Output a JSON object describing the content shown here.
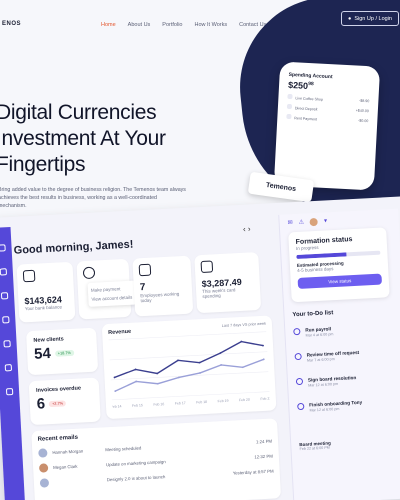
{
  "brand": "ENOS",
  "nav": {
    "items": [
      "Home",
      "About Us",
      "Portfolio",
      "How It Works",
      "Contact Us"
    ],
    "signup": "Sign Up / Login"
  },
  "hero": {
    "line1": "Digital Currencies",
    "line2": "Investment At Your",
    "line3": "Fingertips",
    "subtitle": "Bring added value to the degree of business religion. The Temenos team always achieves the best results in business, working as a well-coordinated mechanism."
  },
  "phone": {
    "title": "Spending Account",
    "amount": "$250",
    "amount_cents": "98",
    "rows": [
      {
        "label": "Live Coffee Shop",
        "value": "-$8.90"
      },
      {
        "label": "Direct Deposit",
        "value": "+$40.00"
      },
      {
        "label": "Rent Payment",
        "value": "-$0.00"
      }
    ]
  },
  "temenos_tag": "Temenos",
  "dashboard": {
    "greeting": "Good morning, James!",
    "balance": {
      "value": "$143,624",
      "label": "Your bank balance"
    },
    "dropdown": [
      "Make payment",
      "View account details"
    ],
    "employees": {
      "value": "7",
      "label": "Employees working today"
    },
    "spending": {
      "value": "$3,287.49",
      "label": "This week's card spending"
    },
    "new_clients": {
      "label": "New clients",
      "value": "54",
      "badge": "+18.7%"
    },
    "invoices": {
      "label": "Invoices overdue",
      "value": "6",
      "badge": "+2.7%"
    },
    "revenue": {
      "label": "Revenue",
      "legend": "Last 7 days VS prior week"
    },
    "recent_emails": "Recent emails",
    "emails": [
      {
        "name": "Hannah Morgan",
        "subject": "Meeting scheduled",
        "time": "1:24 PM"
      },
      {
        "name": "Megan Clark",
        "subject": "Update on marketing campaign",
        "time": "12:32 PM"
      },
      {
        "name": "",
        "subject": "Designly 2.0 is about to launch",
        "time": "Yesterday at 8:57 PM"
      }
    ]
  },
  "formation": {
    "title": "Formation status",
    "status": "In progress",
    "estimate_label": "Estimated processing",
    "estimate_value": "4-5 business days",
    "button": "View status"
  },
  "todo": {
    "title": "Your to-Do list",
    "items": [
      {
        "task": "Run payroll",
        "due": "Mar 4 at 6:00 pm"
      },
      {
        "task": "Review time off request",
        "due": "Mar 7 at 6:00 pm"
      },
      {
        "task": "Sign board resolution",
        "due": "Mar 12 at 6:00 pm"
      },
      {
        "task": "Finish onboarding Tony",
        "due": "Mar 12 at 6:00 pm"
      }
    ],
    "board": {
      "title": "Board meeting",
      "date": "Feb 22 at 6:00 PM"
    }
  },
  "chart_data": {
    "type": "line",
    "series": [
      {
        "values": [
          30,
          34,
          31,
          38,
          36,
          41,
          47,
          44
        ]
      },
      {
        "values": [
          22,
          27,
          25,
          28,
          30,
          34,
          32,
          36
        ]
      }
    ],
    "categories": [
      "Feb 14",
      "Feb 15",
      "Feb 16",
      "Feb 17",
      "Feb 18",
      "Feb 19",
      "Feb 20",
      "Feb 21"
    ],
    "grid": true
  },
  "colors": {
    "accent": "#5548d9",
    "orange": "#e4572e",
    "navy": "#1d2552"
  }
}
